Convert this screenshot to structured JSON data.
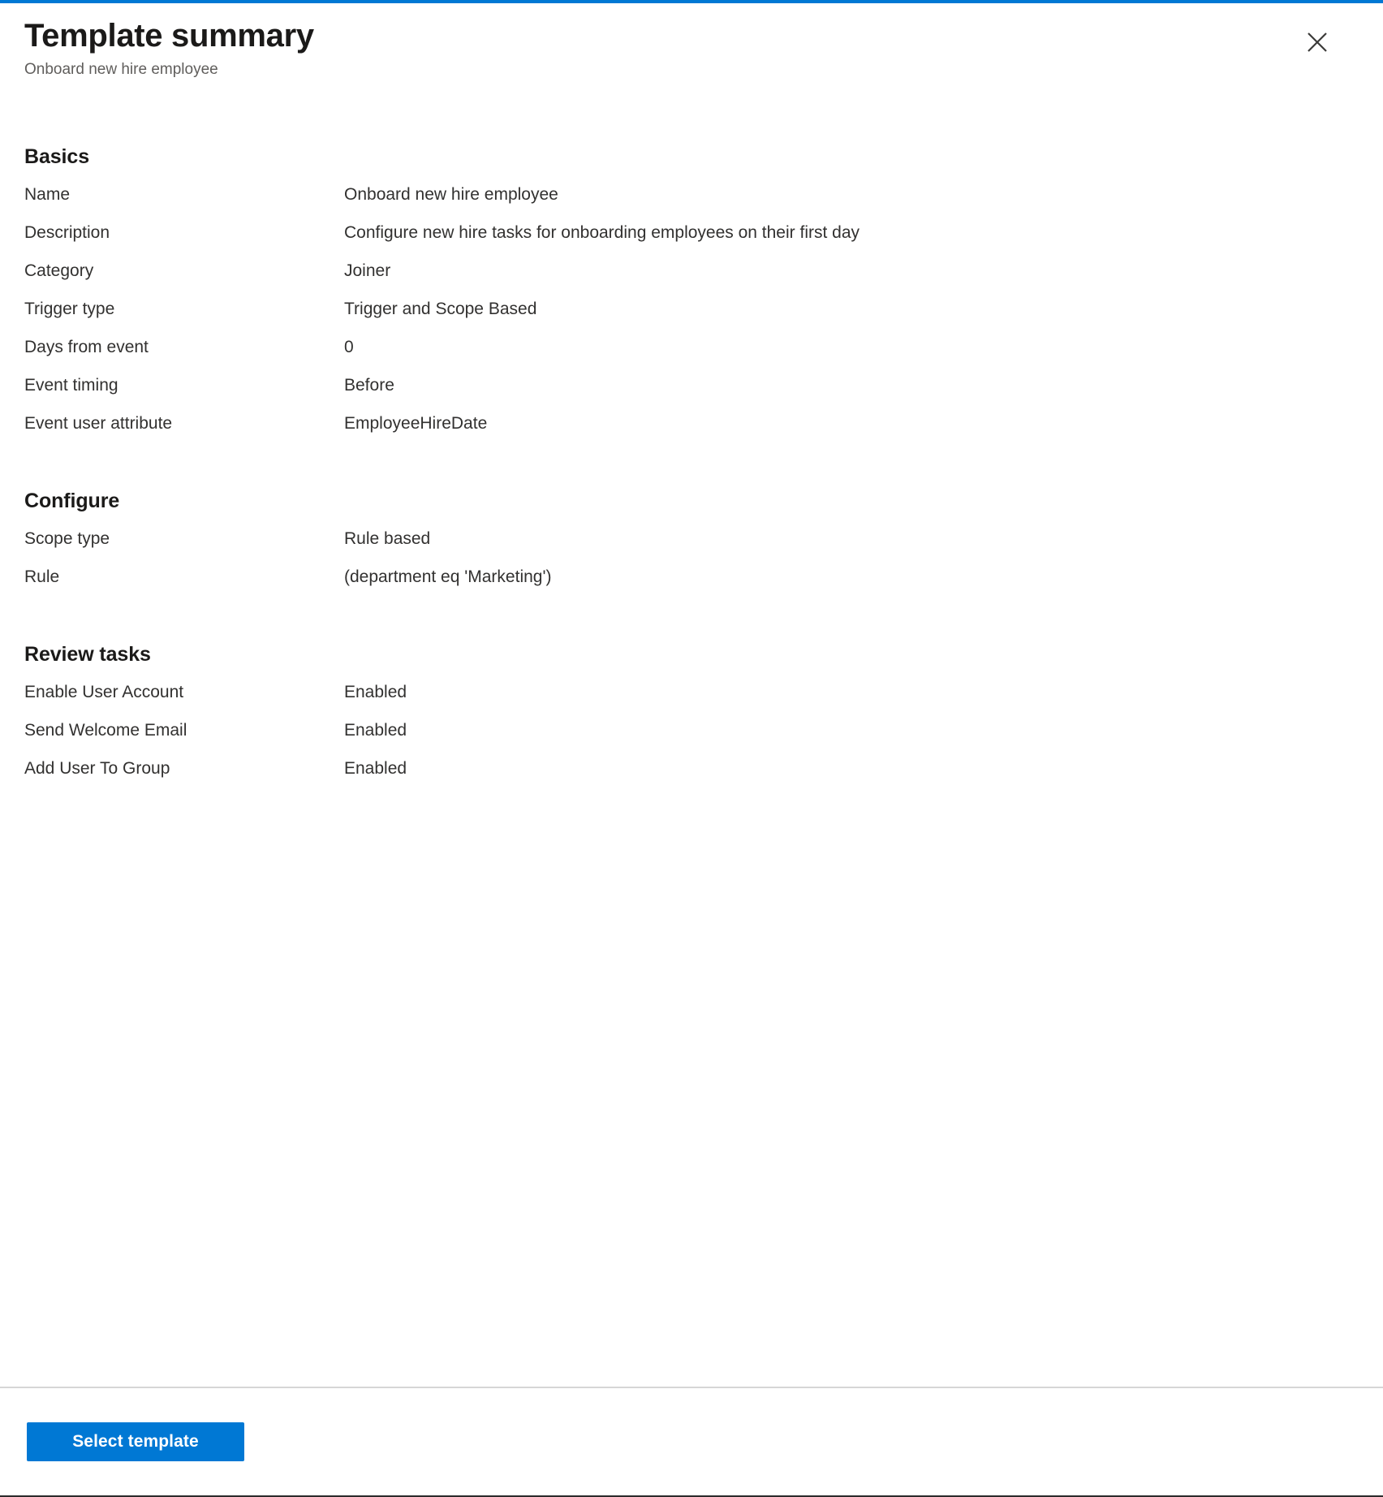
{
  "header": {
    "title": "Template summary",
    "subtitle": "Onboard new hire employee",
    "close_label": "Close",
    "close_icon": "close-icon"
  },
  "colors": {
    "accent": "#0078d4",
    "top_border": "#0078d4",
    "divider": "#d6d6d6",
    "text_primary": "#323130",
    "text_secondary": "#605e5c"
  },
  "sections": [
    {
      "id": "basics",
      "heading": "Basics",
      "rows": [
        {
          "label": "Name",
          "value": "Onboard new hire employee"
        },
        {
          "label": "Description",
          "value": "Configure new hire tasks for onboarding employees on their first day"
        },
        {
          "label": "Category",
          "value": "Joiner"
        },
        {
          "label": "Trigger type",
          "value": "Trigger and Scope Based"
        },
        {
          "label": "Days from event",
          "value": "0"
        },
        {
          "label": "Event timing",
          "value": "Before"
        },
        {
          "label": "Event user attribute",
          "value": "EmployeeHireDate"
        }
      ]
    },
    {
      "id": "configure",
      "heading": "Configure",
      "rows": [
        {
          "label": "Scope type",
          "value": "Rule based"
        },
        {
          "label": "Rule",
          "value": "(department eq 'Marketing')"
        }
      ]
    },
    {
      "id": "review",
      "heading": "Review tasks",
      "rows": [
        {
          "label": "Enable User Account",
          "value": "Enabled"
        },
        {
          "label": "Send Welcome Email",
          "value": "Enabled"
        },
        {
          "label": "Add User To Group",
          "value": "Enabled"
        }
      ]
    }
  ],
  "footer": {
    "select_template_label": "Select template"
  }
}
